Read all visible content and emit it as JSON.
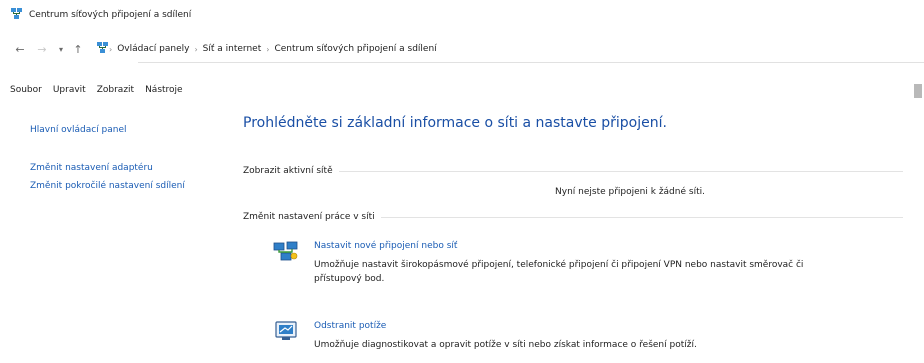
{
  "window": {
    "title": "Centrum síťových připojení a sdílení",
    "icon": "network-icon"
  },
  "address": {
    "back_icon": "back-arrow-icon",
    "forward_icon": "forward-arrow-icon",
    "recent_icon": "chevron-down-icon",
    "up_icon": "up-arrow-icon",
    "location_icon": "network-icon",
    "breadcrumbs": [
      "Ovládací panely",
      "Síť a internet",
      "Centrum síťových připojení a sdílení"
    ]
  },
  "menu": {
    "items": [
      "Soubor",
      "Upravit",
      "Zobrazit",
      "Nástroje"
    ]
  },
  "sidebar": {
    "items": [
      {
        "label": "Hlavní ovládací panel"
      },
      {
        "label": "Změnit nastavení adaptéru"
      },
      {
        "label": "Změnit pokročilé nastavení sdílení"
      }
    ]
  },
  "main": {
    "title": "Prohlédněte si základní informace o síti a nastavte připojení.",
    "active_networks": {
      "label": "Zobrazit aktivní sítě",
      "status": "Nyní nejste připojeni k žádné síti."
    },
    "change_settings": {
      "label": "Změnit nastavení práce v síti",
      "tasks": [
        {
          "icon": "network-setup-icon",
          "link": "Nastavit nové připojení nebo síť",
          "description": "Umožňuje nastavit širokopásmové připojení, telefonické připojení či připojení VPN nebo nastavit směrovač či přístupový bod."
        },
        {
          "icon": "troubleshoot-icon",
          "link": "Odstranit potíže",
          "description": "Umožňuje diagnostikovat a opravit potíže v síti nebo získat informace o řešení potíží."
        }
      ]
    }
  }
}
